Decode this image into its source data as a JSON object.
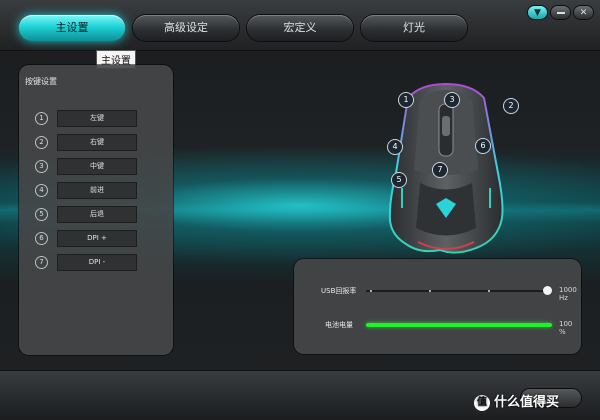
{
  "tabs": [
    {
      "label": "主设置",
      "active": true
    },
    {
      "label": "高级设定",
      "active": false
    },
    {
      "label": "宏定义",
      "active": false
    },
    {
      "label": "灯光",
      "active": false
    }
  ],
  "tooltip": "主设置",
  "window_controls": {
    "menu_icon": "down-triangle-icon",
    "minimize_icon": "minimize-icon",
    "close_icon": "close-icon"
  },
  "key_settings": {
    "title": "按键设置",
    "rows": [
      {
        "num": "1",
        "label": "左键"
      },
      {
        "num": "2",
        "label": "右键"
      },
      {
        "num": "3",
        "label": "中键"
      },
      {
        "num": "4",
        "label": "前进"
      },
      {
        "num": "5",
        "label": "后退"
      },
      {
        "num": "6",
        "label": "DPI +"
      },
      {
        "num": "7",
        "label": "DPI -"
      }
    ]
  },
  "mouse_callouts": [
    "1",
    "2",
    "3",
    "4",
    "5",
    "6",
    "7"
  ],
  "usb": {
    "label": "USB回报率",
    "value": "1000 Hz",
    "level": 1.0
  },
  "battery": {
    "label": "电池电量",
    "value": "100 %",
    "level": 1.0
  },
  "watermark": {
    "icon": "值",
    "text": "什么值得买"
  },
  "colors": {
    "accent": "#1fd2d6",
    "battery": "#1bf52a",
    "panel": "#444648"
  }
}
